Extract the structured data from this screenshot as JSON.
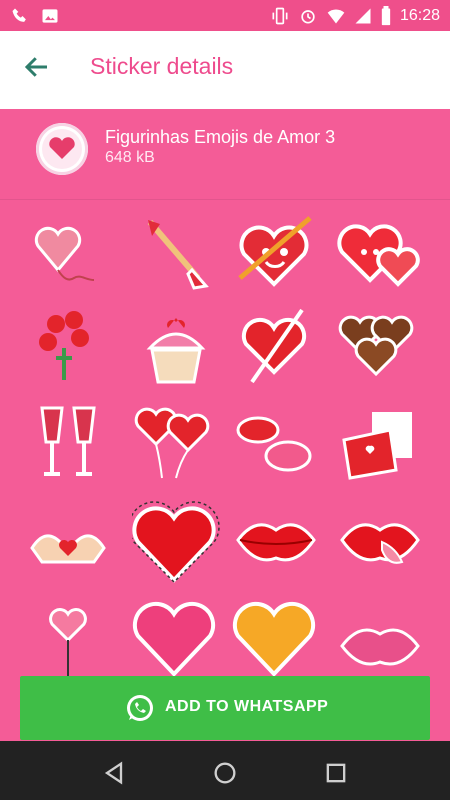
{
  "status_bar": {
    "time": "16:28"
  },
  "toolbar": {
    "title": "Sticker details"
  },
  "pack": {
    "name": "Figurinhas Emojis de Amor 3",
    "size": "648 kB"
  },
  "add_button": {
    "label": "ADD TO WHATSAPP"
  },
  "stickers": [
    {
      "icon": "heart-balloon-icon"
    },
    {
      "icon": "cupid-arrow-icon"
    },
    {
      "icon": "heart-with-arrow-face-icon"
    },
    {
      "icon": "two-hearts-faces-icon"
    },
    {
      "icon": "flower-bouquet-icon"
    },
    {
      "icon": "cupcake-icon"
    },
    {
      "icon": "heart-arrow-icon"
    },
    {
      "icon": "chocolates-icon"
    },
    {
      "icon": "wine-glasses-icon"
    },
    {
      "icon": "heart-balloons-icon"
    },
    {
      "icon": "kiss-lips-icon"
    },
    {
      "icon": "love-letter-icon"
    },
    {
      "icon": "hand-heart-icon"
    },
    {
      "icon": "big-red-heart-icon"
    },
    {
      "icon": "lips-kiss-icon"
    },
    {
      "icon": "tongue-lips-icon"
    },
    {
      "icon": "heart-lollipop-icon"
    },
    {
      "icon": "pink-heart-icon"
    },
    {
      "icon": "gold-heart-icon"
    },
    {
      "icon": "pink-lips-icon"
    }
  ],
  "colors": {
    "accent": "#f45c97",
    "toolbar_title": "#ee4b8d",
    "button": "#3fbe47"
  }
}
